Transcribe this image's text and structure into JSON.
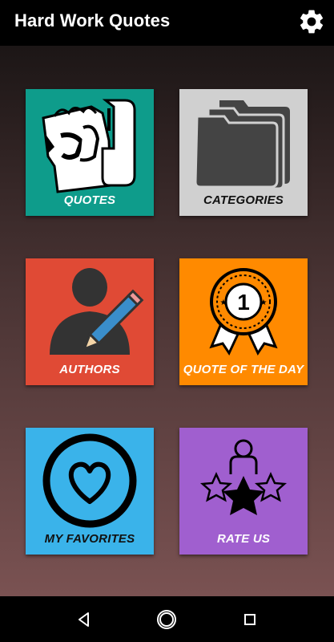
{
  "app": {
    "title": "Hard Work Quotes"
  },
  "tiles": [
    {
      "label": "QUOTES",
      "color": "#0e9c8b",
      "icon": "fist-icon"
    },
    {
      "label": "CATEGORIES",
      "color": "#d0d0d0",
      "icon": "folders-icon"
    },
    {
      "label": "AUTHORS",
      "color": "#e04a35",
      "icon": "author-pencil-icon"
    },
    {
      "label": "QUOTE OF THE DAY",
      "color": "#ff8a00",
      "icon": "award-ribbon-icon"
    },
    {
      "label": "MY FAVORITES",
      "color": "#3ab3ea",
      "icon": "heart-icon"
    },
    {
      "label": "RATE US",
      "color": "#a05fcf",
      "icon": "rate-stars-icon"
    }
  ],
  "badge": {
    "number": "1"
  },
  "navbar": {
    "buttons": [
      "back-icon",
      "home-icon",
      "recents-icon"
    ]
  }
}
